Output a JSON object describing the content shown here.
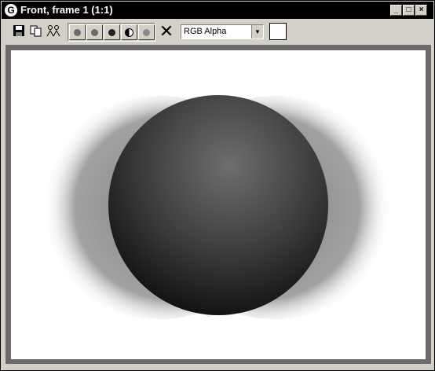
{
  "window": {
    "title": "Front, frame 1 (1:1)"
  },
  "title_buttons": [
    "minimize",
    "maximize",
    "close"
  ],
  "toolbar": {
    "buttons": [
      "save-icon",
      "copy-icon",
      "clone-icon"
    ],
    "channel_buttons": [
      "red-channel",
      "green-channel",
      "blue-channel",
      "alpha-channel",
      "monochrome"
    ],
    "clear_button": "clear-icon",
    "channel_select": "RGB Alpha",
    "color_swatch": "#ffffff"
  },
  "colors": {
    "titlebar": "#000000",
    "chrome": "#d4d0c8",
    "viewport_border": "#6b6b6b",
    "canvas": "#ffffff"
  }
}
